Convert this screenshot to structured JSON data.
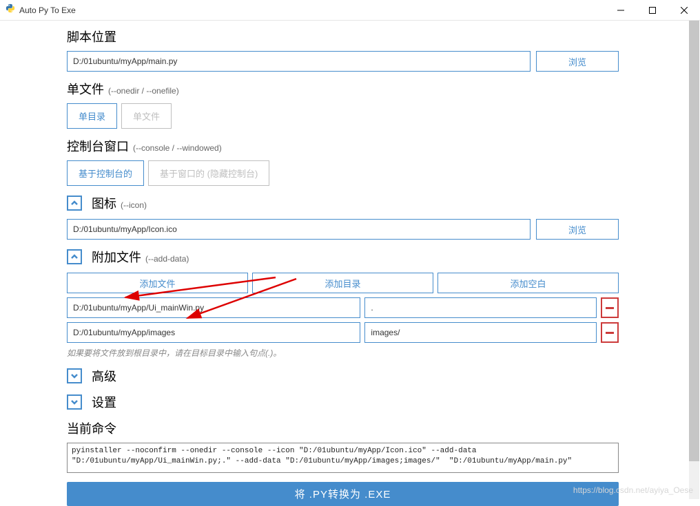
{
  "window": {
    "title": "Auto Py To Exe"
  },
  "script": {
    "heading": "脚本位置",
    "path": "D:/01ubuntu/myApp/main.py",
    "browse": "浏览"
  },
  "onefile": {
    "heading": "单文件",
    "sub": "(--onedir / --onefile)",
    "opt_onedir": "单目录",
    "opt_onefile": "单文件"
  },
  "console": {
    "heading": "控制台窗口",
    "sub": "(--console / --windowed)",
    "opt_console": "基于控制台的",
    "opt_windowed": "基于窗口的 (隐藏控制台)"
  },
  "icon": {
    "heading": "图标",
    "sub": "(--icon)",
    "path": "D:/01ubuntu/myApp/Icon.ico",
    "browse": "浏览"
  },
  "adddata": {
    "heading": "附加文件",
    "sub": "(--add-data)",
    "add_file": "添加文件",
    "add_dir": "添加目录",
    "add_blank": "添加空白",
    "rows": [
      {
        "src": "D:/01ubuntu/myApp/Ui_mainWin.py",
        "dst": "."
      },
      {
        "src": "D:/01ubuntu/myApp/images",
        "dst": "images/"
      }
    ],
    "hint": "如果要将文件放到根目录中，请在目标目录中输入句点(.)。"
  },
  "advanced": {
    "heading": "高级"
  },
  "settings": {
    "heading": "设置"
  },
  "command": {
    "heading": "当前命令",
    "text": "pyinstaller --noconfirm --onedir --console --icon \"D:/01ubuntu/myApp/Icon.ico\" --add-data \"D:/01ubuntu/myApp/Ui_mainWin.py;.\" --add-data \"D:/01ubuntu/myApp/images;images/\"  \"D:/01ubuntu/myApp/main.py\""
  },
  "convert": {
    "label": "将 .PY转换为 .EXE"
  },
  "watermark": "https://blog.csdn.net/ayiya_Oese"
}
